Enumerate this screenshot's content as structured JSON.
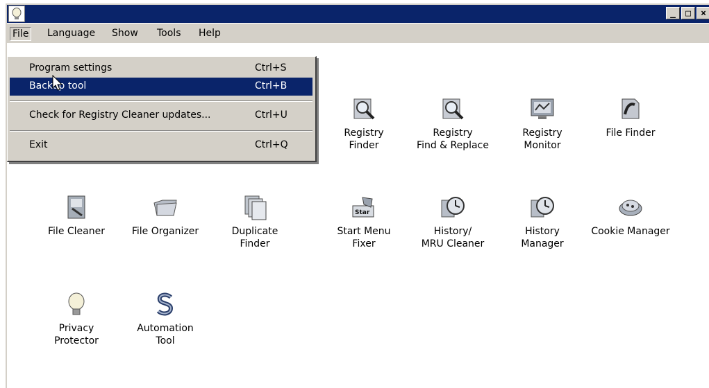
{
  "window": {
    "title": "",
    "controls": [
      "_",
      "□",
      "×"
    ]
  },
  "menubar": {
    "items": [
      {
        "label": "File"
      },
      {
        "label": "Language"
      },
      {
        "label": "Show"
      },
      {
        "label": "Tools"
      },
      {
        "label": "Help"
      }
    ]
  },
  "file_menu": {
    "items": [
      {
        "label": "Program settings",
        "shortcut": "Ctrl+S"
      },
      {
        "label": "Backup tool",
        "shortcut": "Ctrl+B",
        "selected": true
      },
      {
        "label": "Check for Registry Cleaner updates...",
        "shortcut": "Ctrl+U"
      },
      {
        "label": "Exit",
        "shortcut": "Ctrl+Q"
      }
    ]
  },
  "tools": [
    {
      "label": "Registry\nFinder",
      "icon": "registry-finder-icon"
    },
    {
      "label": "Registry\nFind & Replace",
      "icon": "registry-find-replace-icon"
    },
    {
      "label": "Registry\nMonitor",
      "icon": "registry-monitor-icon"
    },
    {
      "label": "File Finder",
      "icon": "file-finder-icon"
    },
    {
      "label": "File Cleaner",
      "icon": "file-cleaner-icon"
    },
    {
      "label": "File Organizer",
      "icon": "file-organizer-icon"
    },
    {
      "label": "Duplicate\nFinder",
      "icon": "duplicate-finder-icon"
    },
    {
      "label": "Start Menu\nFixer",
      "icon": "start-menu-fixer-icon"
    },
    {
      "label": "History/\nMRU Cleaner",
      "icon": "history-mru-cleaner-icon"
    },
    {
      "label": "History\nManager",
      "icon": "history-manager-icon"
    },
    {
      "label": "Cookie Manager",
      "icon": "cookie-manager-icon"
    },
    {
      "label": "Privacy\nProtector",
      "icon": "privacy-protector-icon"
    },
    {
      "label": "Automation\nTool",
      "icon": "automation-tool-icon"
    }
  ],
  "colors": {
    "titlebar": "#0a246a",
    "chrome": "#d4d0c8",
    "selection": "#0a246a"
  }
}
